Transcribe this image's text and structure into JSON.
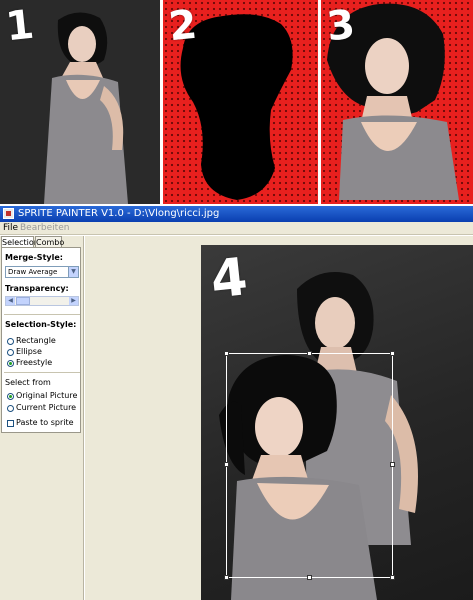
{
  "panels": [
    {
      "number": "1"
    },
    {
      "number": "2"
    },
    {
      "number": "3"
    }
  ],
  "window": {
    "title": "SPRITE PAINTER V1.0 - D:\\Vlong\\ricci.jpg"
  },
  "menu": {
    "file": "File",
    "edit": "Bearbeiten"
  },
  "sidepanel": {
    "tabs": [
      "Selection",
      "Combo"
    ],
    "merge_style_label": "Merge-Style:",
    "merge_style_value": "Draw Average",
    "transparency_label": "Transparency:",
    "selection_style_label": "Selection-Style:",
    "selection_options": [
      "Rectangle",
      "Ellipse",
      "Freestyle"
    ],
    "selection_selected": "Freestyle",
    "select_from_label": "Select from",
    "select_from_options": [
      "Original Picture",
      "Current Picture"
    ],
    "select_from_selected": "Original Picture",
    "paste_label": "Paste to sprite"
  },
  "canvas": {
    "number": "4"
  },
  "colors": {
    "panel_red": "#e8201e",
    "titlebar_blue": "#0a3fb0",
    "window_bg": "#ece9d8"
  }
}
